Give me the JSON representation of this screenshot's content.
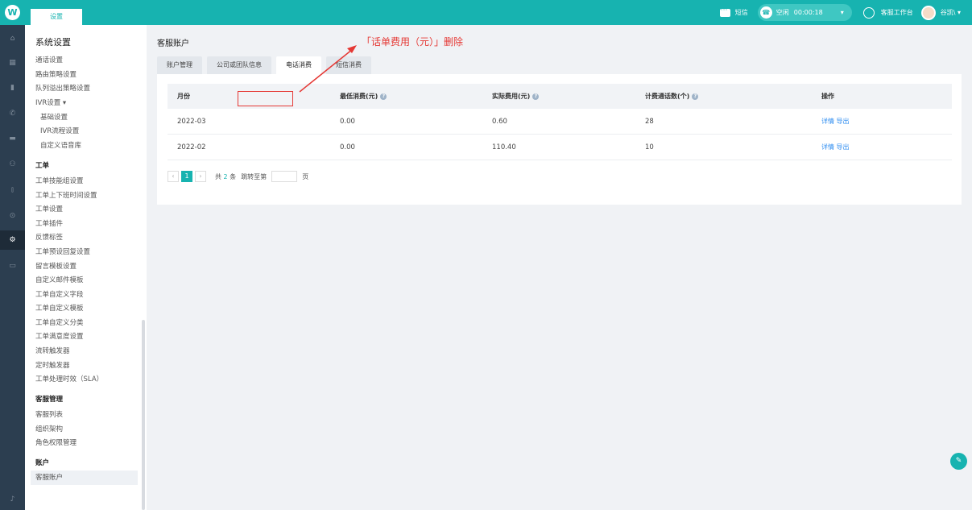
{
  "topbar": {
    "logo_glyph": "W",
    "tab": "设置",
    "sms": "短信",
    "status": "空闲",
    "timer": "00:00:18",
    "workbench": "客服工作台",
    "user": "谷凯\\ ▾"
  },
  "sidebar": {
    "title": "系统设置",
    "groups": [
      {
        "name": "",
        "items": [
          "通话设置",
          "路由策略设置",
          "队列溢出策略设置",
          "IVR设置 ▾"
        ]
      },
      {
        "name": "",
        "items": [
          "基础设置",
          "IVR流程设置",
          "自定义语音库"
        ]
      },
      {
        "name": "工单",
        "items": [
          "工单技能组设置",
          "工单上下班时间设置",
          "工单设置",
          "工单插件",
          "反馈标签",
          "工单预设回复设置",
          "留言模板设置",
          "自定义邮件模板",
          "工单自定义字段",
          "工单自定义模板",
          "工单自定义分类",
          "工单满意度设置",
          "流转触发器",
          "定时触发器",
          "工单处理时效（SLA）"
        ]
      },
      {
        "name": "客服管理",
        "items": [
          "客服列表",
          "组织架构",
          "角色权限管理"
        ]
      },
      {
        "name": "账户",
        "items": [
          "客服账户"
        ]
      }
    ]
  },
  "main": {
    "title": "客服账户",
    "tabs": [
      "账户管理",
      "公司或团队信息",
      "电话消费",
      "短信消费"
    ],
    "active_tab": 2,
    "columns": [
      "月份",
      "最低消费(元)",
      "实际费用(元)",
      "计费通话数(个)",
      "操作"
    ],
    "rows": [
      {
        "month": "2022-03",
        "min": "0.00",
        "actual": "0.60",
        "calls": "28",
        "actions": "详情 导出"
      },
      {
        "month": "2022-02",
        "min": "0.00",
        "actual": "110.40",
        "calls": "10",
        "actions": "详情 导出"
      }
    ],
    "pager": {
      "prev": "‹",
      "current": "1",
      "next": "›",
      "total_prefix": "共",
      "total": "2",
      "total_suffix": "条",
      "jump": "跳转至第",
      "page": "页"
    }
  },
  "annotation": {
    "text": "「话单费用（元）」删除",
    "color": "#e53935"
  },
  "colors": {
    "accent": "#17b3b0",
    "link": "#2d8cf0",
    "iconbar": "#2c3e50"
  }
}
